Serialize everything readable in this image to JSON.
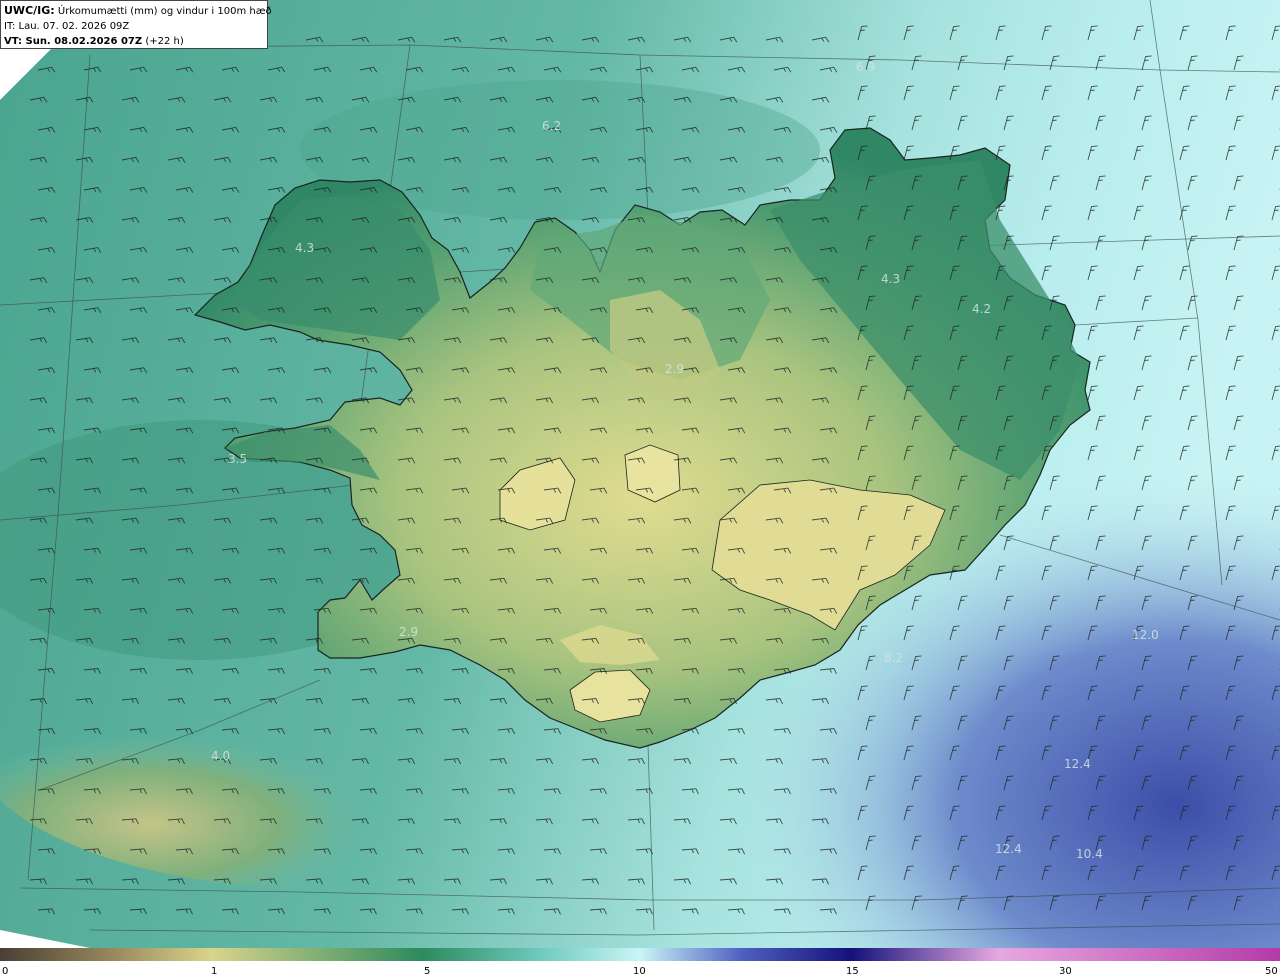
{
  "header": {
    "title_prefix": "UWC/IG:",
    "title_text": "Úrkomumætti (mm) og vindur i 100m hæð",
    "it_line": "IT: Lau. 07. 02. 2026 09Z",
    "vt_prefix": "VT: Sun. 08.02.2026 07Z",
    "vt_suffix": "(+22 h)"
  },
  "value_labels": [
    "6.9",
    "6.2",
    "4.3",
    "4.3",
    "4.2",
    "2.9",
    "3.5",
    "2.9",
    "4.0",
    "8.2",
    "12.0",
    "12.4",
    "12.4",
    "10.4"
  ],
  "colorbar": {
    "ticks": [
      "0",
      "1",
      "5",
      "10",
      "15",
      "30",
      "50"
    ],
    "colors": [
      "#4a3f35",
      "#9a8a5e",
      "#d9d48a",
      "#2d8a5f",
      "#6cc9bd",
      "#c9f5f5",
      "#4f5fc0",
      "#14127a",
      "#e7a8e0",
      "#b43aa8"
    ]
  },
  "palette": {
    "ocean": "#6fc2b4",
    "ocean_light": "#b8ecea",
    "land_dark": "#2f8766",
    "land_mid": "#5aa878",
    "land_yellow": "#d6d58a",
    "deep_blue": "#4a5fb5"
  }
}
